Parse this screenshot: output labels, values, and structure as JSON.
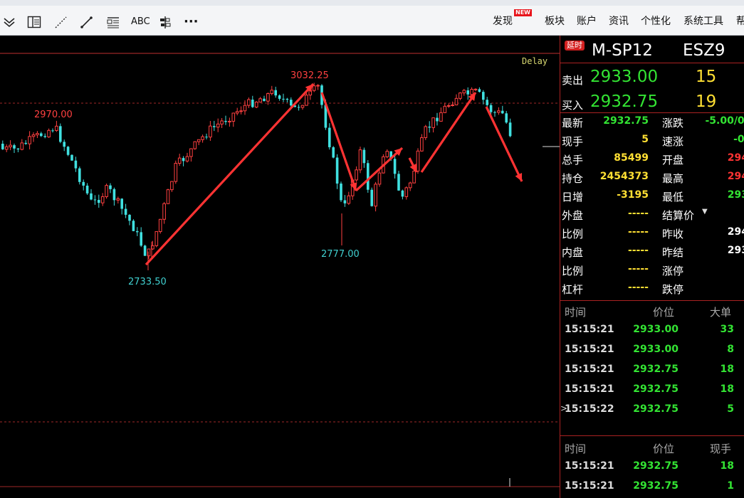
{
  "toolbar": {
    "tools": [
      "chevron-double-down-icon",
      "layout-panel-icon",
      "dashed-line-icon",
      "line-tool-icon",
      "text-list-icon"
    ],
    "abc_label": "ABC",
    "more_label": "···",
    "menus": [
      "发现",
      "板块",
      "账户",
      "资讯",
      "个性化",
      "系统工具",
      "帮"
    ],
    "new_badge": "NEW"
  },
  "chart": {
    "delay_label": "Delay",
    "annotations": [
      "3032.25",
      "2970.00",
      "2777.00",
      "2733.50"
    ]
  },
  "quote": {
    "delay_badge": "延时",
    "name": "M-SP12",
    "code": "ESZ9",
    "ask_label": "卖出",
    "ask_price": "2933.00",
    "ask_size": "15",
    "bid_label": "买入",
    "bid_price": "2932.75",
    "bid_size": "19",
    "left": [
      {
        "label": "最新",
        "value": "2932.75",
        "color": "#33e433"
      },
      {
        "label": "现手",
        "value": "5",
        "color": "#ffe033"
      },
      {
        "label": "总手",
        "value": "85499",
        "color": "#ffe033"
      },
      {
        "label": "持仓",
        "value": "2454373",
        "color": "#ffe033"
      },
      {
        "label": "日增",
        "value": "-3195",
        "color": "#ffe033"
      },
      {
        "label": "外盘",
        "value": "-----",
        "color": "#ffe033"
      },
      {
        "label": "比例",
        "value": "-----",
        "color": "#ffe033"
      },
      {
        "label": "内盘",
        "value": "-----",
        "color": "#ffe033"
      },
      {
        "label": "比例",
        "value": "-----",
        "color": "#ffe033"
      },
      {
        "label": "杠杆",
        "value": "-----",
        "color": "#ffe033"
      }
    ],
    "right": [
      {
        "label": "涨跌",
        "value": "-5.00/0.",
        "color": "#33e433"
      },
      {
        "label": "速涨",
        "value": "-0.",
        "color": "#33e433"
      },
      {
        "label": "开盘",
        "value": "294",
        "color": "#ff3333"
      },
      {
        "label": "最高",
        "value": "294",
        "color": "#ff3333"
      },
      {
        "label": "最低",
        "value": "293",
        "color": "#33e433"
      },
      {
        "label": "结算价",
        "value": "",
        "color": "#ffffff"
      },
      {
        "label": "昨收",
        "value": "294",
        "color": "#ffffff"
      },
      {
        "label": "昨结",
        "value": "293",
        "color": "#ffffff"
      },
      {
        "label": "涨停",
        "value": "",
        "color": "#ffffff"
      },
      {
        "label": "跌停",
        "value": "",
        "color": "#ffffff"
      }
    ]
  },
  "trades1": {
    "headers": [
      "时间",
      "价位",
      "大单"
    ],
    "rows": [
      {
        "time": "15:15:21",
        "price": "2933.00",
        "vol": "33"
      },
      {
        "time": "15:15:21",
        "price": "2933.00",
        "vol": "8"
      },
      {
        "time": "15:15:21",
        "price": "2932.75",
        "vol": "18"
      },
      {
        "time": "15:15:21",
        "price": "2932.75",
        "vol": "18"
      },
      {
        "time": "15:15:22",
        "price": "2932.75",
        "vol": "5"
      }
    ]
  },
  "trades2": {
    "headers": [
      "时间",
      "价位",
      "现手"
    ],
    "rows": [
      {
        "time": "15:15:21",
        "price": "2932.75",
        "vol": "18"
      },
      {
        "time": "15:15:21",
        "price": "2932.75",
        "vol": "1"
      }
    ]
  }
}
